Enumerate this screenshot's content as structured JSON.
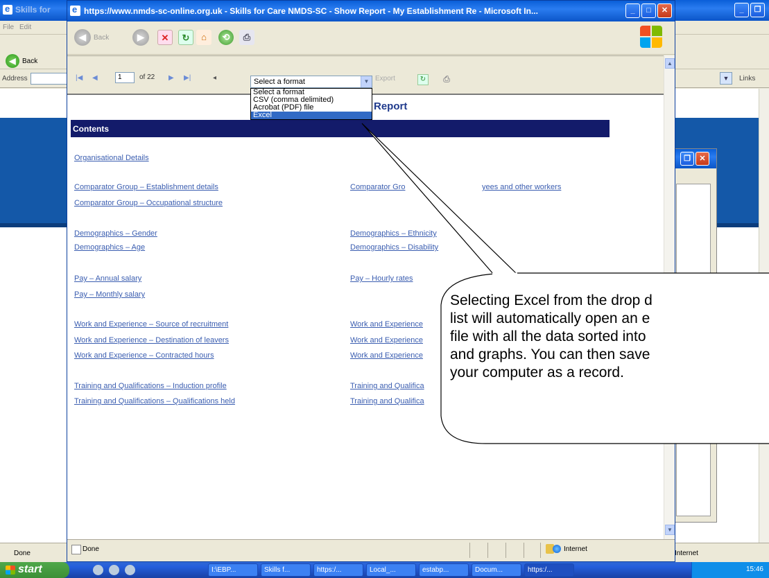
{
  "bg_window": {
    "title": "Skills for",
    "menu": [
      "File",
      "Edit"
    ],
    "back_label": "Back",
    "address_label": "Address",
    "links_label": "Links",
    "status_done": "Done",
    "status_internet": "Internet"
  },
  "popup": {
    "title": "https://www.nmds-sc-online.org.uk - Skills for Care NMDS-SC - Show Report - My Establishment Re - Microsoft In...",
    "toolbar": {
      "back_label": "Back"
    },
    "report_toolbar": {
      "page_value": "1",
      "page_of": "of 22",
      "format_selected": "Select a format",
      "export_label": "Export",
      "format_options": [
        "Select a format",
        "CSV (comma delimited)",
        "Acrobat (PDF) file",
        "Excel"
      ],
      "format_highlighted": "Excel"
    },
    "report_title": "Report",
    "contents_label": "Contents",
    "links_left": [
      "Organisational Details",
      "Comparator Group – Establishment details",
      "Comparator Group – Occupational structure",
      "Demographics – Gender",
      "Demographics – Age",
      "Pay – Annual salary",
      "Pay – Monthly salary",
      "Work and Experience – Source of recruitment",
      "Work and Experience – Destination of leavers",
      "Work and Experience – Contracted hours",
      "Training and Qualifications – Induction profile",
      "Training and Qualifications – Qualifications held"
    ],
    "links_right": [
      "Comparator Gro",
      "yees and other workers",
      "Demographics – Ethnicity",
      "Demographics – Disability",
      "Pay – Hourly rates",
      "Work and Experience",
      "Work and Experience",
      "Work and Experience",
      "Training and Qualifica",
      "Training and Qualifica"
    ],
    "status_done": "Done",
    "status_internet": "Internet"
  },
  "callout": {
    "lines": [
      "Selecting Excel from the drop d",
      "list will automatically open an e",
      "file with all the data sorted into",
      "and graphs. You can then save",
      "your computer as a record."
    ]
  },
  "taskbar": {
    "start_label": "start",
    "tasks": [
      "I:\\EBP...",
      "Skills f...",
      "https:/...",
      "Local_...",
      "estabp...",
      "Docum...",
      "https:/..."
    ],
    "time": "15:46"
  },
  "colors": {
    "titlebar": "#0a5fd8",
    "contents_bar": "#131b6a",
    "link": "#3a5db0",
    "highlight": "#316ac5"
  }
}
